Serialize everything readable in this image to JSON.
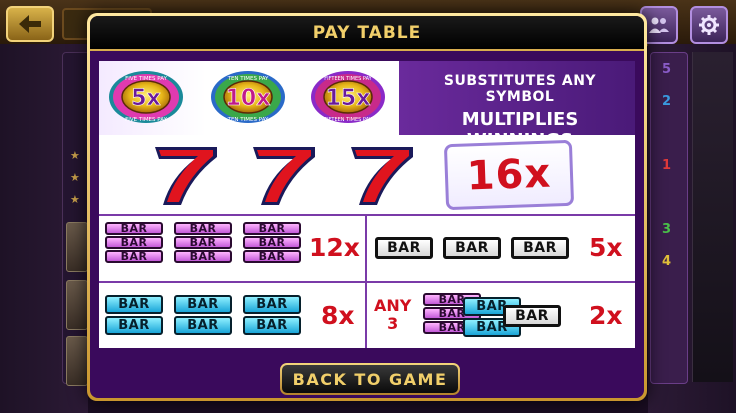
{
  "modal": {
    "title": "PAY TABLE",
    "back_label": "BACK TO GAME"
  },
  "wild": {
    "symbols": [
      {
        "multiplier": "5x",
        "ring_text": "FIVE TIMES PAY"
      },
      {
        "multiplier": "10x",
        "ring_text": "TEN TIMES PAY"
      },
      {
        "multiplier": "15x",
        "ring_text": "FIFTEEN TIMES PAY"
      }
    ],
    "line1": "SUBSTITUTES ANY SYMBOL",
    "line2": "MULTIPLIES WINNINGS"
  },
  "paytable": {
    "seven_multiplier": "16x",
    "triple_pink_bar_multiplier": "12x",
    "single_bar_multiplier": "5x",
    "double_blue_bar_multiplier": "8x",
    "any_bar_multiplier": "2x",
    "any_label_line1": "ANY",
    "any_label_line2": "3",
    "bar_text": "BAR"
  },
  "paylines": {
    "numbers": [
      "5",
      "2",
      "1",
      "3",
      "4"
    ],
    "colors": [
      "#8a5cc8",
      "#3a9be0",
      "#e03a3a",
      "#4ac04a",
      "#e0c03a"
    ]
  },
  "colors": {
    "accent_gold": "#f1cf6a",
    "modal_purple": "#3a0a5c",
    "payout_red": "#d0101e"
  }
}
